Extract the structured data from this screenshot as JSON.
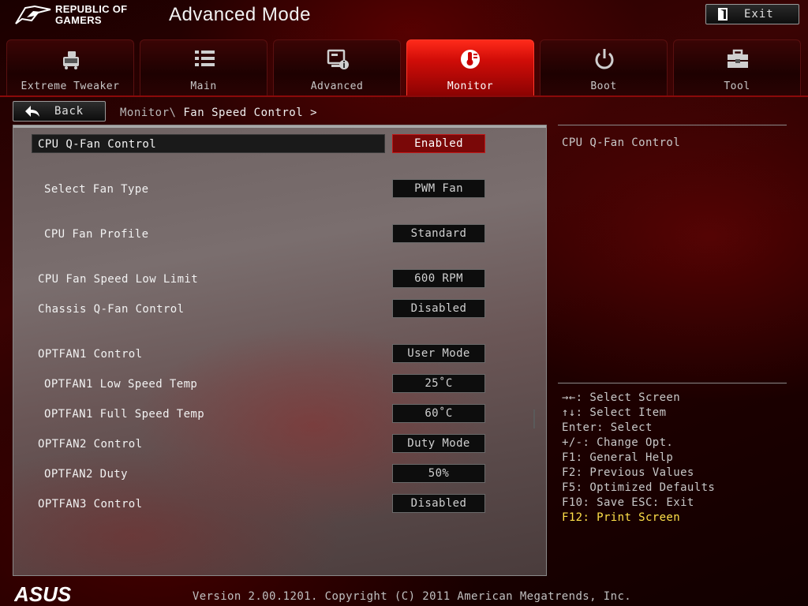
{
  "header": {
    "brand_line1": "REPUBLIC OF",
    "brand_line2": "GAMERS",
    "title": "Advanced Mode",
    "exit_label": "Exit"
  },
  "tabs": [
    {
      "label": "Extreme Tweaker",
      "icon": "extreme-tweaker-icon",
      "active": false
    },
    {
      "label": "Main",
      "icon": "list-icon",
      "active": false
    },
    {
      "label": "Advanced",
      "icon": "advanced-settings-icon",
      "active": false
    },
    {
      "label": "Monitor",
      "icon": "thermometer-icon",
      "active": true
    },
    {
      "label": "Boot",
      "icon": "power-icon",
      "active": false
    },
    {
      "label": "Tool",
      "icon": "toolbox-icon",
      "active": false
    }
  ],
  "nav": {
    "back_label": "Back",
    "breadcrumb_parent": "Monitor\\",
    "breadcrumb_current": "Fan Speed Control >"
  },
  "settings": [
    {
      "label": "CPU Q-Fan Control",
      "value": "Enabled"
    },
    {
      "label": "Select Fan Type",
      "value": "PWM Fan"
    },
    {
      "label": "CPU Fan Profile",
      "value": "Standard"
    },
    {
      "label": "CPU Fan Speed Low Limit",
      "value": "600 RPM"
    },
    {
      "label": "Chassis Q-Fan Control",
      "value": "Disabled"
    },
    {
      "label": "OPTFAN1 Control",
      "value": "User Mode"
    },
    {
      "label": "OPTFAN1 Low Speed Temp",
      "value": "25˚C"
    },
    {
      "label": "OPTFAN1 Full Speed Temp",
      "value": "60˚C"
    },
    {
      "label": "OPTFAN2 Control",
      "value": "Duty Mode"
    },
    {
      "label": "OPTFAN2 Duty",
      "value": "50%"
    },
    {
      "label": "OPTFAN3 Control",
      "value": "Disabled"
    }
  ],
  "help": {
    "title": "CPU Q-Fan Control",
    "keys": [
      "→←: Select Screen",
      "↑↓: Select Item",
      "Enter: Select",
      "+/-: Change Opt.",
      "F1: General Help",
      "F2: Previous Values",
      "F5: Optimized Defaults",
      "F10: Save  ESC: Exit",
      "F12: Print Screen"
    ]
  },
  "footer": {
    "brand": "ASUS",
    "version_text": "Version 2.00.1201. Copyright (C) 2011 American Megatrends, Inc."
  },
  "colors": {
    "accent_red": "#d10d08",
    "selected_value_bg": "#7a0808",
    "help_highlight": "#ffe14a"
  }
}
